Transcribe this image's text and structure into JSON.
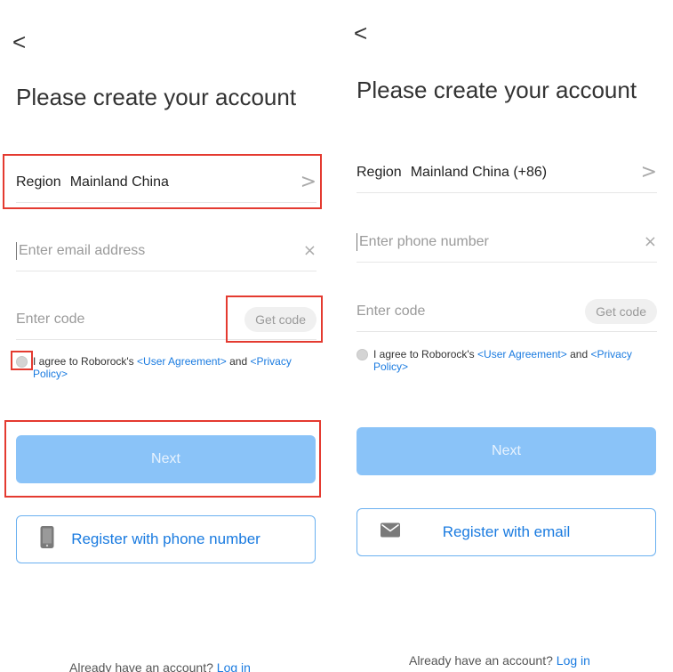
{
  "left": {
    "back": "<",
    "title": "Please create your account",
    "region_key": "Region",
    "region_value": "Mainland China",
    "chevron": ">",
    "email_placeholder": "Enter email address",
    "clear": "×",
    "code_placeholder": "Enter code",
    "get_code": "Get code",
    "agree_prefix": "I agree to Roborock's ",
    "user_agreement": "<User Agreement>",
    "agree_and": " and ",
    "privacy_policy": "<Privacy Policy>",
    "next": "Next",
    "alt_register": "Register with phone number",
    "alt_icon": "phone-icon",
    "footer_text": "Already have an account? ",
    "footer_link": "Log in"
  },
  "right": {
    "back": "<",
    "title": "Please create your account",
    "region_key": "Region",
    "region_value": "Mainland China (+86)",
    "chevron": ">",
    "phone_placeholder": "Enter phone number",
    "clear": "×",
    "code_placeholder": "Enter code",
    "get_code": "Get code",
    "agree_prefix": "I agree to Roborock's ",
    "user_agreement": "<User Agreement>",
    "agree_and": " and ",
    "privacy_policy": "<Privacy Policy>",
    "next": "Next",
    "alt_register": "Register with email",
    "alt_icon": "mail-icon",
    "footer_text": "Already have an account? ",
    "footer_link": "Log in"
  },
  "colors": {
    "accent": "#1a7be0",
    "next_disabled": "#8ac3f8",
    "highlight": "#e43a30"
  }
}
